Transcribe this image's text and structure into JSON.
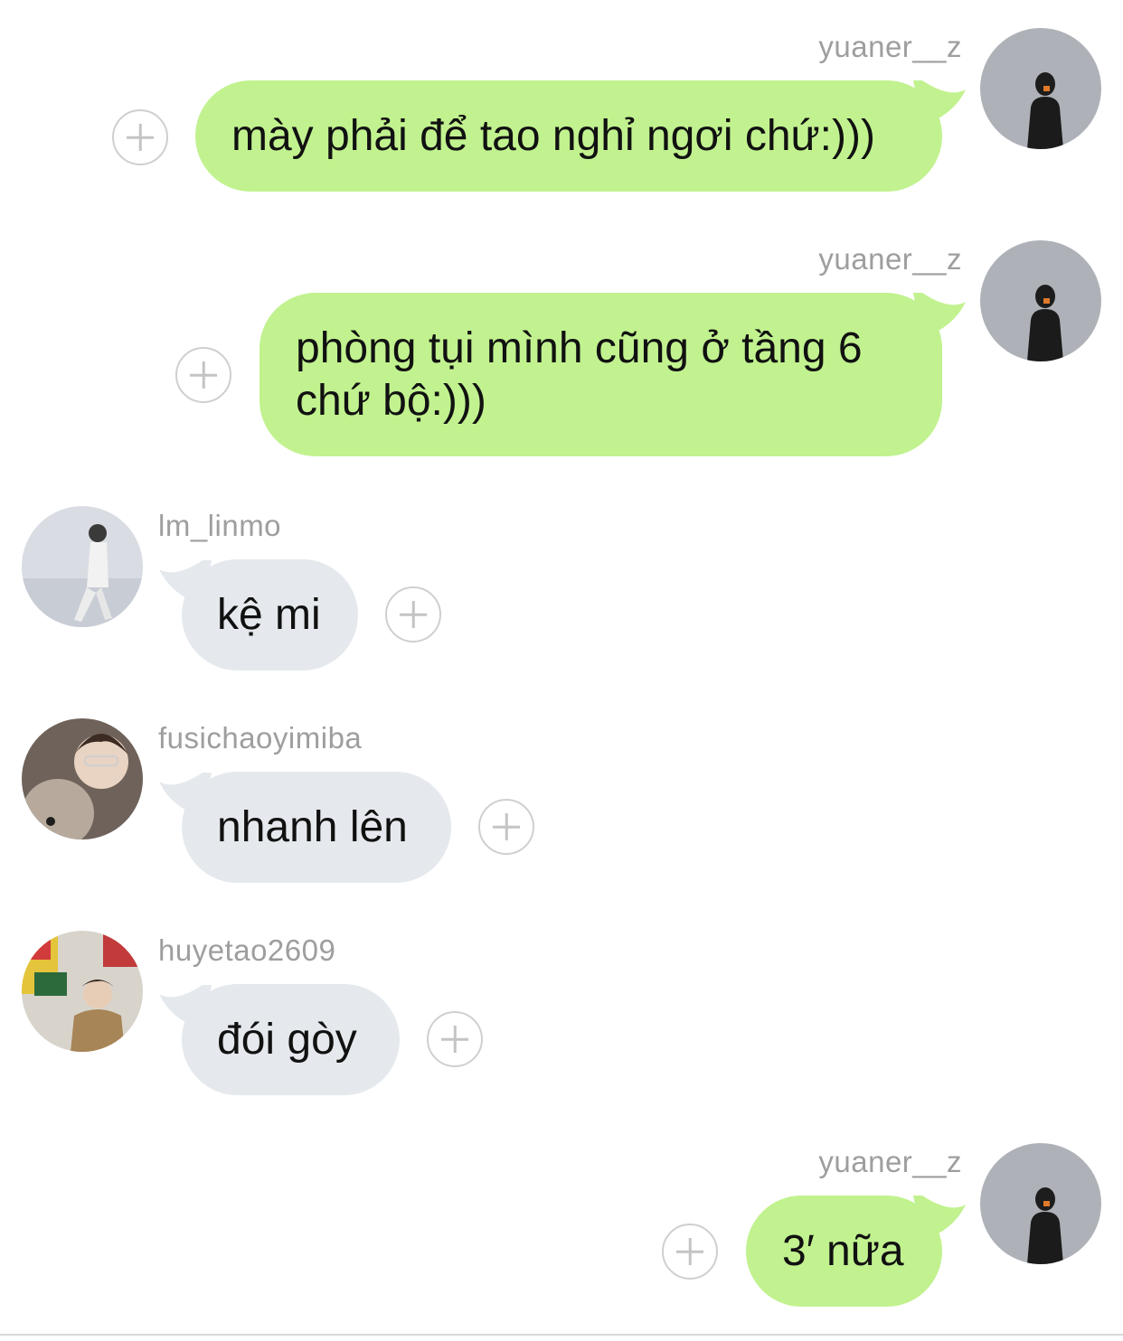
{
  "chat": {
    "messages": [
      {
        "sender": "yuaner__z",
        "direction": "outgoing",
        "text": "mày phải để tao nghỉ ngơi chứ:)))"
      },
      {
        "sender": "yuaner__z",
        "direction": "outgoing",
        "text_lines": [
          "phòng tụi mình cũng ở tầng 6",
          "chứ bộ:)))"
        ]
      },
      {
        "sender": "lm_linmo",
        "direction": "incoming",
        "text": "kệ mi"
      },
      {
        "sender": "fusichaoyimiba",
        "direction": "incoming",
        "text": "nhanh lên"
      },
      {
        "sender": "huyetao2609",
        "direction": "incoming",
        "text": "đói gòy"
      },
      {
        "sender": "yuaner__z",
        "direction": "outgoing",
        "text": "3′ nữa"
      }
    ]
  },
  "icons": {
    "add_reaction": "plus-circle-icon",
    "avatar": "user-avatar-photo"
  },
  "colors": {
    "outgoing_bubble": "#c1f28f",
    "incoming_bubble": "#e5e9ed",
    "username_text": "#9e9e9e",
    "message_text": "#111111",
    "background": "#ffffff"
  }
}
